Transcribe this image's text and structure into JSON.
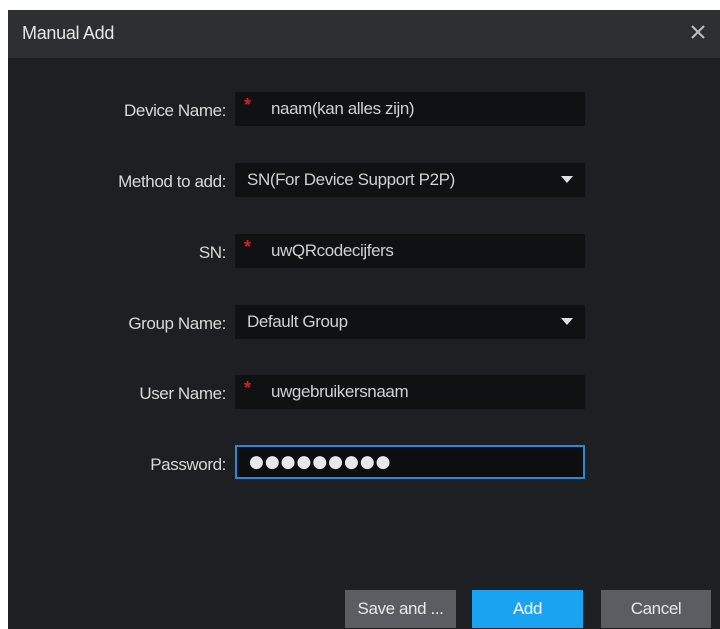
{
  "dialog": {
    "title": "Manual Add",
    "close_icon": "close-icon"
  },
  "form": {
    "device_name": {
      "label": "Device Name:",
      "value": "naam(kan alles zijn)",
      "required": true
    },
    "method_to_add": {
      "label": "Method to add:",
      "value": "SN(For Device Support P2P)"
    },
    "sn": {
      "label": "SN:",
      "value": "uwQRcodecijfers",
      "required": true
    },
    "group_name": {
      "label": "Group Name:",
      "value": "Default Group"
    },
    "user_name": {
      "label": "User Name:",
      "value": "uwgebruikersnaam",
      "required": true
    },
    "password": {
      "label": "Password:",
      "value": "●●●●●●●●●"
    },
    "required_marker": "*"
  },
  "buttons": {
    "save_and": "Save and ...",
    "add": "Add",
    "cancel": "Cancel"
  },
  "colors": {
    "dialog_bg": "#1e1f22",
    "titlebar_bg": "#2e2f33",
    "field_bg": "#101113",
    "required": "#d42020",
    "accent": "#1aa3f0",
    "focus_border": "#2f86d6",
    "button_grey": "#5b5d62"
  }
}
